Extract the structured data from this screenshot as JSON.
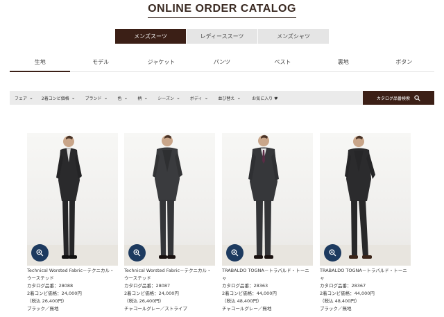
{
  "page_title": "ONLINE ORDER CATALOG",
  "category_tabs": [
    {
      "label": "メンズスーツ",
      "active": true
    },
    {
      "label": "レディーススーツ",
      "active": false
    },
    {
      "label": "メンズシャツ",
      "active": false
    }
  ],
  "sub_tabs": [
    "生地",
    "モデル",
    "ジャケット",
    "パンツ",
    "ベスト",
    "裏地",
    "ボタン"
  ],
  "filters": [
    "フェア",
    "2着コンビ価格",
    "ブランド",
    "色",
    "柄",
    "シーズン",
    "ボディ",
    "並び替え"
  ],
  "favorites_label": "お気に入り ♥",
  "search_button_label": "カタログ品番検索",
  "products": [
    {
      "name": "Technical Worsted Fabric－テクニカル・ウーステッド",
      "catalog_no": "カタログ品番：28088",
      "price": "2着コンビ価格：24,000円",
      "tax_price": "（税込 26,400円）",
      "color": "ブラック／無地",
      "suit": "#2a2a2c"
    },
    {
      "name": "Technical Worsted Fabric－テクニカル・ウーステッド",
      "catalog_no": "カタログ品番：28087",
      "price": "2着コンビ価格：24,000円",
      "tax_price": "（税込 26,400円）",
      "color": "チャコールグレー／ストライプ",
      "suit": "#3a3b3e"
    },
    {
      "name": "TRABALDO TOGNA－トラバルド・トーニャ",
      "catalog_no": "カタログ品番：28363",
      "price": "2着コンビ価格：44,000円",
      "tax_price": "（税込 48,400円）",
      "color": "チャコールグレー／無地",
      "suit": "#36373a"
    },
    {
      "name": "TRABALDO TOGNA－トラバルド・トーニャ",
      "catalog_no": "カタログ品番：28367",
      "price": "2着コンビ価格：44,000円",
      "tax_price": "（税込 48,400円）",
      "color": "ブラック／無地",
      "suit": "#2b2b2d"
    }
  ]
}
